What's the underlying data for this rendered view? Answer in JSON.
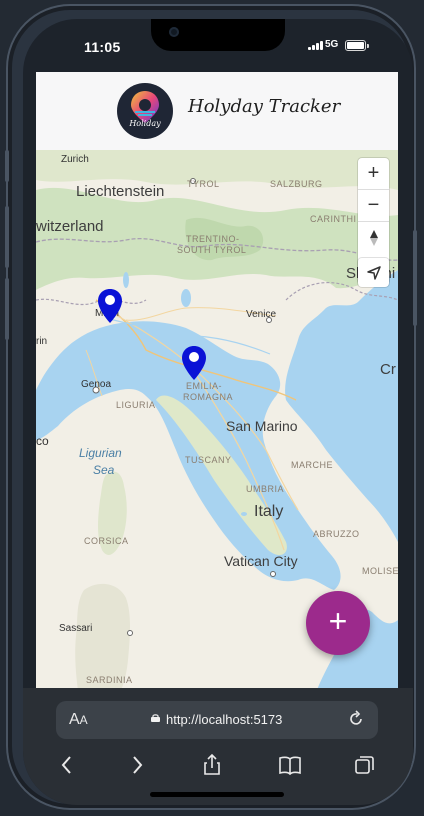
{
  "status_bar": {
    "time": "11:05",
    "network": "5G"
  },
  "header": {
    "title": "Holyday Tracker",
    "logo_text": "Holiday"
  },
  "map": {
    "labels": {
      "zurich": "Zurich",
      "liechtenstein": "Liechtenstein",
      "switzerland": "witzerland",
      "tyrol": "TYROL",
      "salzburg": "SALZBURG",
      "carinthia": "CARINTHI",
      "trentino": "TRENTINO-",
      "south_tyrol": "SOUTH TYROL",
      "slovenia": "Sloveni",
      "milan": "Milan",
      "venice": "Venice",
      "cr": "Cr",
      "rin": "rin",
      "genoa": "Genoa",
      "liguria": "LIGURIA",
      "emilia": "EMILIA-",
      "romagna": "ROMAGNA",
      "san_marino": "San Marino",
      "co": "co",
      "ligurian_sea": "Ligurian",
      "sea": "Sea",
      "tuscany": "TUSCANY",
      "marche": "MARCHE",
      "umbria": "UMBRIA",
      "italy": "Italy",
      "corsica": "CORSICA",
      "abruzzo": "ABRUZZO",
      "vatican": "Vatican City",
      "molise": "MOLISE",
      "sassari": "Sassari",
      "sardinia": "SARDINIA"
    },
    "controls": {
      "zoom_in": "+",
      "zoom_out": "−"
    }
  },
  "fab": {
    "label": "+"
  },
  "browser": {
    "text_size": "A",
    "text_size_small": "A",
    "url": "http://localhost:5173"
  },
  "colors": {
    "marker": "#0a12d6",
    "fab": "#9c2a8c"
  }
}
